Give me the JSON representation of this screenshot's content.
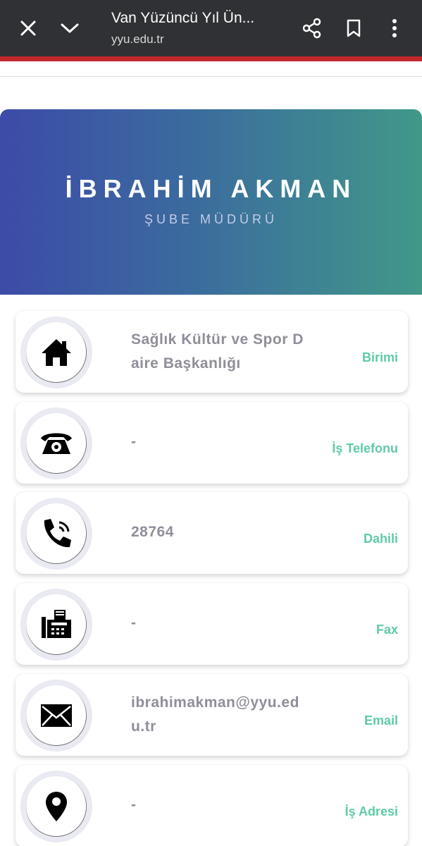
{
  "browser": {
    "page_title": "Van Yüzüncü Yıl Ün...",
    "url": "yyu.edu.tr",
    "icons": [
      "close-icon",
      "chevron-down-icon",
      "share-icon",
      "bookmark-icon",
      "more-vert-icon"
    ]
  },
  "profile": {
    "name": "İBRAHİM AKMAN",
    "title": "ŞUBE MÜDÜRÜ"
  },
  "contact_cards": [
    {
      "icon": "home-icon",
      "value": "Sağlık Kültür ve Spor Daire Başkanlığı",
      "label": "Birimi"
    },
    {
      "icon": "telephone-icon",
      "value": "-",
      "label": "İş Telefonu"
    },
    {
      "icon": "phone-call-icon",
      "value": "28764",
      "label": "Dahili"
    },
    {
      "icon": "fax-icon",
      "value": "-",
      "label": "Fax"
    },
    {
      "icon": "envelope-icon",
      "value": "ibrahimakman@yyu.edu.tr",
      "label": "Email"
    },
    {
      "icon": "location-pin-icon",
      "value": "-",
      "label": "İş Adresi"
    }
  ],
  "colors": {
    "toolbar_bg": "#303134",
    "accent_red": "#c0272d",
    "gradient_start": "#3d4ba8",
    "gradient_end": "#419889",
    "label_green": "#5fcba5",
    "value_gray": "#8f8e9a"
  }
}
